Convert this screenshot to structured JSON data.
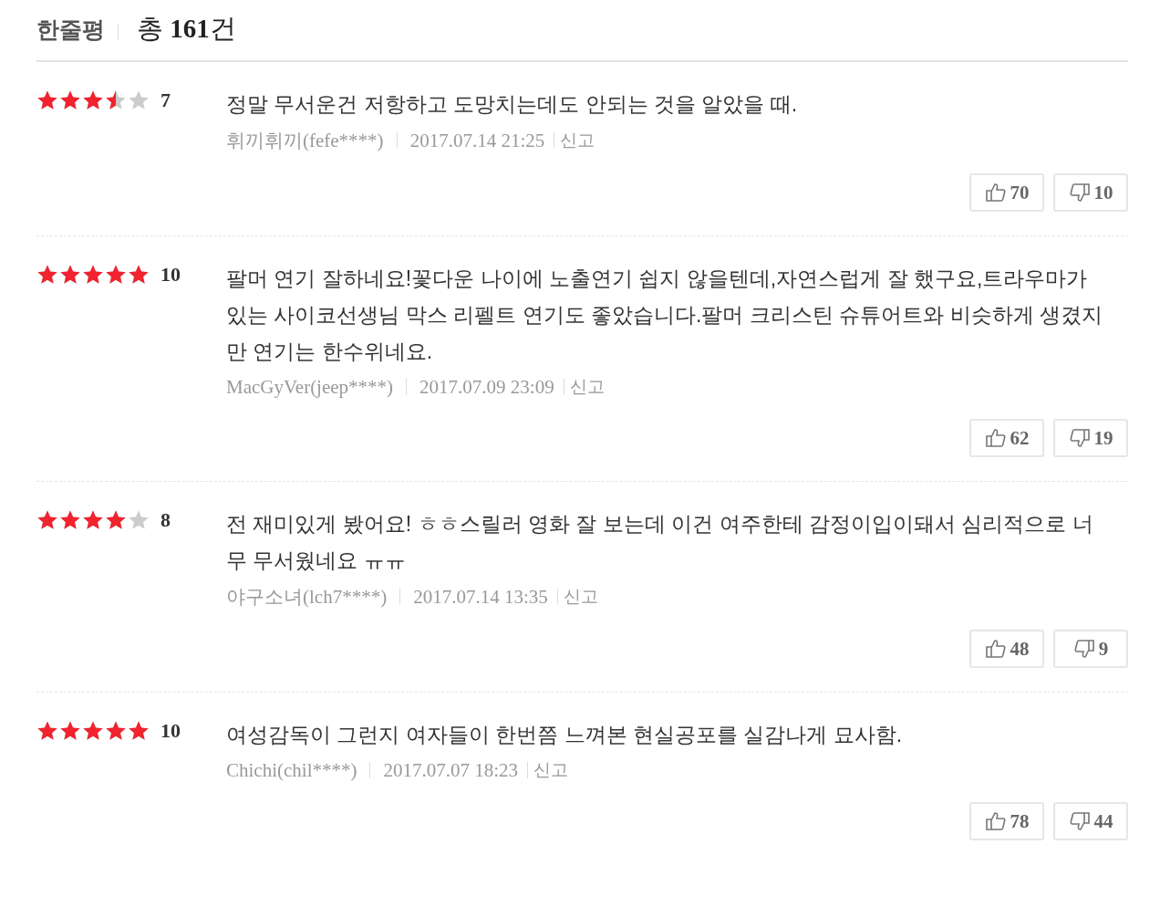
{
  "header": {
    "title": "한줄평",
    "total": "총 **161**건"
  },
  "reviews": [
    {
      "stars": 3.5,
      "score": "7",
      "text": "정말 무서운건 저항하고 도망치는데도 안되는 것을 알았을 때.",
      "author": "휘끼휘끼(fefe****)",
      "date": "2017.07.14 21:25",
      "report": "신고",
      "likes": "70",
      "dislikes": "10"
    },
    {
      "stars": 5,
      "score": "10",
      "text": "팔머 연기 잘하네요!꽃다운 나이에 노출연기 쉽지 않을텐데,자연스럽게 잘 했구요,트라우마가 있는 사이코선생님 막스 리펠트 연기도 좋았습니다.팔머 크리스틴 슈튜어트와 비슷하게 생겼지만 연기는 한수위네요.",
      "author": "MacGyVer(jeep****)",
      "date": "2017.07.09 23:09",
      "report": "신고",
      "likes": "62",
      "dislikes": "19"
    },
    {
      "stars": 4,
      "score": "8",
      "text": "전 재미있게 봤어요! ㅎㅎ스릴러 영화 잘 보는데 이건 여주한테 감정이입이돼서 심리적으로 너무 무서웠네요 ㅠㅠ",
      "author": "야구소녀(lch7****)",
      "date": "2017.07.14 13:35",
      "report": "신고",
      "likes": "48",
      "dislikes": "9"
    },
    {
      "stars": 5,
      "score": "10",
      "text": "여성감독이 그런지 여자들이 한번쯤 느껴본 현실공포를 실감나게 묘사함.",
      "author": "Chichi(chil****)",
      "date": "2017.07.07 18:23",
      "report": "신고",
      "likes": "78",
      "dislikes": "44"
    }
  ]
}
